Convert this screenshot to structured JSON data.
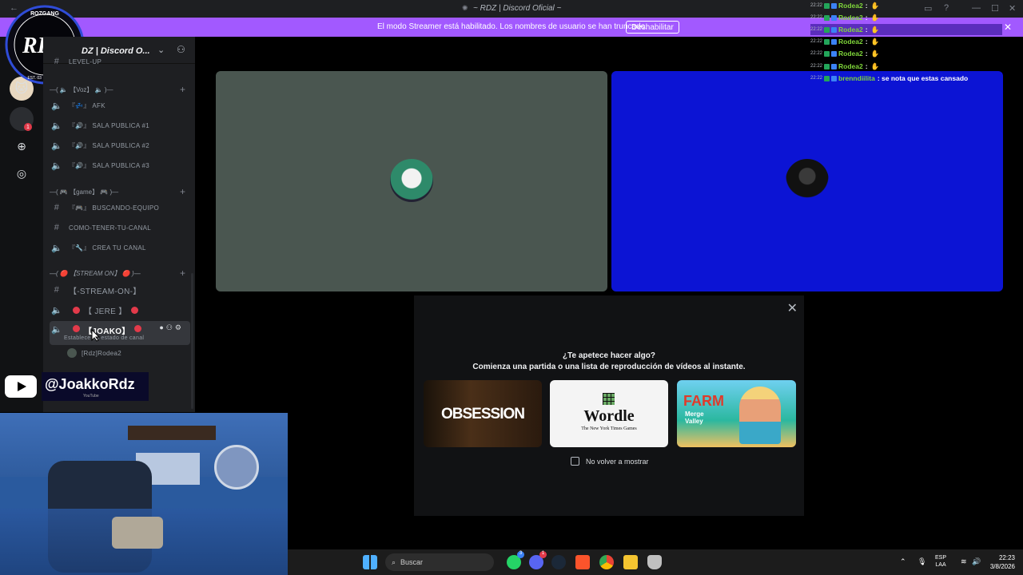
{
  "window": {
    "title": "~ RDZ | Discord Oficial ~"
  },
  "banner": {
    "message": "El modo Streamer está habilitado. Los nombres de usuario se han truncado.",
    "button_label": "Deshabilitar"
  },
  "logo": {
    "text": "RDZ",
    "arc_text": "ROZGANG",
    "date_text": "EST. 03 · 05 · 2020"
  },
  "server": {
    "name": "DZ | Discord O..."
  },
  "channels": {
    "level_up": "LEVEL-UP",
    "voz_category": "—( 🔈 【Voz】 🔈 )—",
    "afk": "『💤』 AFK",
    "sala1": "『🔊』 SALA PUBLICA #1",
    "sala2": "『🔊』 SALA PUBLICA #2",
    "sala3": "『🔊』 SALA PUBLICA #3",
    "game_category": "—( 🎮 【game】 🎮 )—",
    "buscando": "『🎮』 BUSCANDO-EQUIPO",
    "como_tener": "COMO-TENER-TU-CANAL",
    "crea": "『🔧』 CREA TU CANAL",
    "stream_category": "—( 🔴 【STREAM ON】 🔴 )—",
    "stream_on": "【-STREAM-ON-】",
    "jere": "【 JERE 】",
    "joako": "【JOAKO】",
    "status_hint": "Establece un estado de canal",
    "user_below": "[Rdz]Rodea2"
  },
  "youtube": {
    "handle": "@JoakkoRdz",
    "sub": "YouTube"
  },
  "chat": [
    {
      "time": "22:22",
      "user": "Rodea2",
      "text": ":",
      "color": "#7fd63a"
    },
    {
      "time": "22:22",
      "user": "Rodea2",
      "text": ":",
      "color": "#7fd63a"
    },
    {
      "time": "22:22",
      "user": "Rodea2",
      "text": ":",
      "color": "#7fd63a"
    },
    {
      "time": "22:22",
      "user": "Rodea2",
      "text": ":",
      "color": "#7fd63a"
    },
    {
      "time": "22:22",
      "user": "Rodea2",
      "text": ":",
      "color": "#7fd63a"
    },
    {
      "time": "22:22",
      "user": "Rodea2",
      "text": ":",
      "color": "#7fd63a"
    },
    {
      "time": "22:22",
      "user": "brenndiilita",
      "text": ": se nota que estas cansado",
      "color": "#7fd63a"
    }
  ],
  "modal": {
    "question": "¿Te apetece hacer algo?",
    "subtitle": "Comienza una partida o una lista de reproducción de vídeos al instante.",
    "activities": [
      "OBSESSION",
      "Wordle",
      "Farm Merge Valley"
    ],
    "wordle_sub": "The New York Times Games",
    "farm_line1": "FARM",
    "farm_line2": "Merge Valley",
    "dont_show": "No volver a mostrar"
  },
  "taskbar": {
    "search_placeholder": "Buscar",
    "lang1": "ESP",
    "lang2": "LAA",
    "time": "22:23",
    "date": "3/8/2026",
    "badges": {
      "whatsapp": "3",
      "discord": "1"
    }
  },
  "colors": {
    "banner": "#a259ff",
    "tile_left": "#4a5650",
    "tile_right": "#0c14d4",
    "discord_bg": "#1e1f22"
  }
}
